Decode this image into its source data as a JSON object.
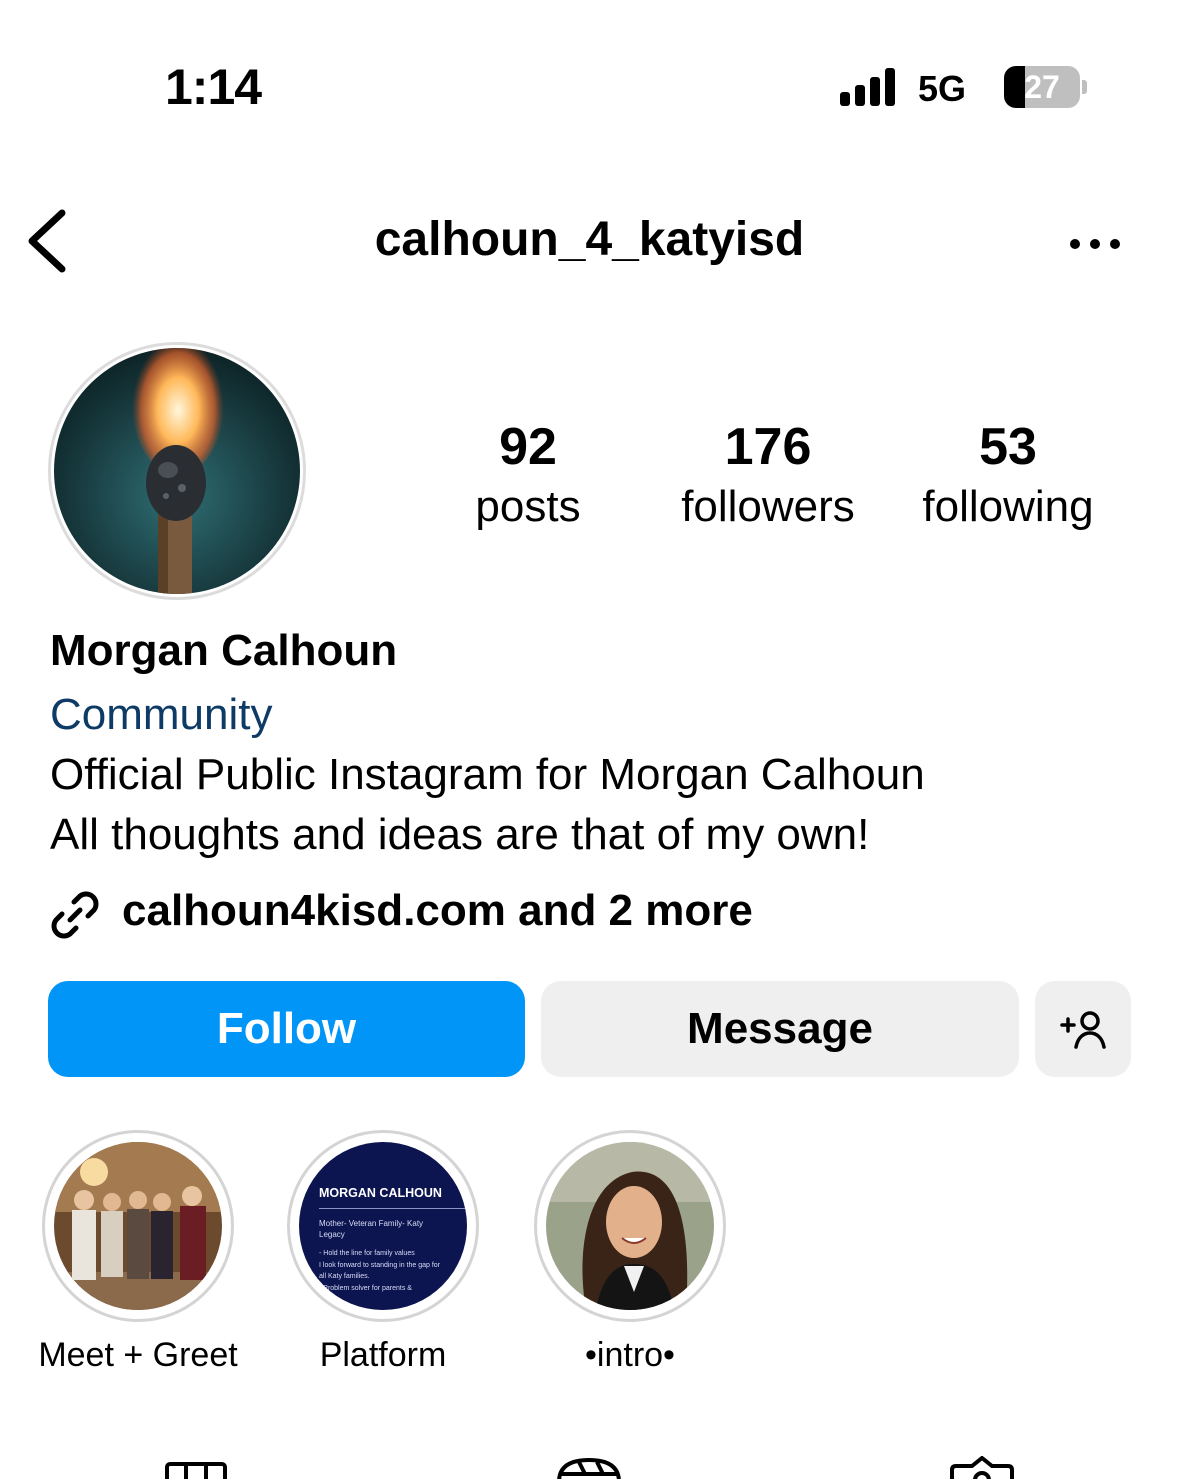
{
  "status_bar": {
    "time": "1:14",
    "network": "5G",
    "battery": "27",
    "battery_level": 0.27
  },
  "header": {
    "username": "calhoun_4_katyisd",
    "back_icon": "chevron-left-icon",
    "more_icon": "ellipsis-icon"
  },
  "profile": {
    "stats": [
      {
        "value": "92",
        "label": "posts"
      },
      {
        "value": "176",
        "label": "followers"
      },
      {
        "value": "53",
        "label": "following"
      }
    ],
    "name": "Morgan Calhoun",
    "category": "Community",
    "bio_lines": [
      "Official Public Instagram for Morgan Calhoun",
      "All thoughts and ideas are that of my own!"
    ],
    "link_text": "calhoun4kisd.com and 2 more"
  },
  "actions": {
    "follow": "Follow",
    "message": "Message",
    "add_user_icon": "add-person-icon"
  },
  "highlights": [
    {
      "label": "Meet + Greet"
    },
    {
      "label": "Platform",
      "card_title": "MORGAN CALHOUN",
      "card_subtitle": "Mother- Veteran Family- Katy Legacy",
      "card_lines": [
        "- Hold the line for family values",
        "I look forward to standing in the gap for",
        "all Katy families.",
        "- Problem solver for parents &"
      ]
    },
    {
      "label": "•intro•"
    }
  ],
  "colors": {
    "follow_button": "#0095f6",
    "secondary_button": "#efefef",
    "category_text": "#0d3b66"
  }
}
